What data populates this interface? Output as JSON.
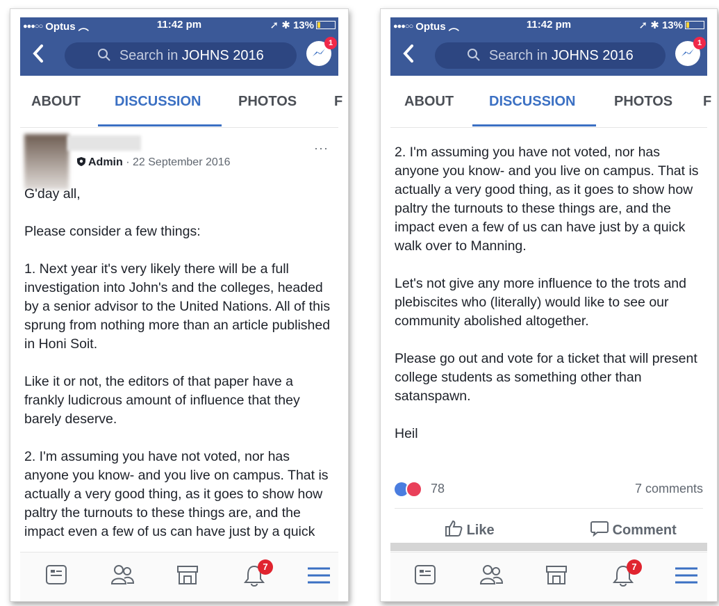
{
  "colors": {
    "brand": "#3b5998",
    "active_tab": "#3b70c3",
    "badge": "#f02849"
  },
  "status_bar": {
    "carrier": "Optus",
    "time": "11:42 pm",
    "battery": "13%"
  },
  "nav": {
    "search_prefix": "Search in",
    "group_name": "JOHNS 2016",
    "messenger_badge": "1"
  },
  "tabs": [
    {
      "label": "ABOUT"
    },
    {
      "label": "DISCUSSION"
    },
    {
      "label": "PHOTOS"
    },
    {
      "label": "F"
    }
  ],
  "post": {
    "role": "Admin",
    "date": "· 22 September 2016",
    "more": "···",
    "greeting": "G'day all,",
    "paragraphs": [
      "Please consider a few things:",
      "1. Next year it's very likely there will be a full investigation into John's and the colleges, headed by a senior advisor to the United Nations. All of this sprung from nothing more than an article published in Honi Soit.",
      "Like it or not, the editors of that paper have a frankly ludicrous amount of influence that they barely deserve.",
      "2. I'm assuming you have not voted, nor has anyone you know- and you live on campus. That is actually a very good thing, as it goes to show how paltry the turnouts to these things are, and the impact even a few of us can have just by a quick walk over to Manning.",
      "Let's not give any more influence to the trots and plebiscites who (literally) would like to see our community abolished altogether.",
      "Please go out and vote for a ticket that will present college students as something other than satanspawn.",
      "Heil"
    ],
    "left_tail": "can have just by a quick walk over to",
    "reaction_count": "78",
    "comment_count": "7 comments",
    "like_label": "Like",
    "comment_label": "Comment"
  },
  "bottom_bar": {
    "notifications_badge": "7"
  }
}
